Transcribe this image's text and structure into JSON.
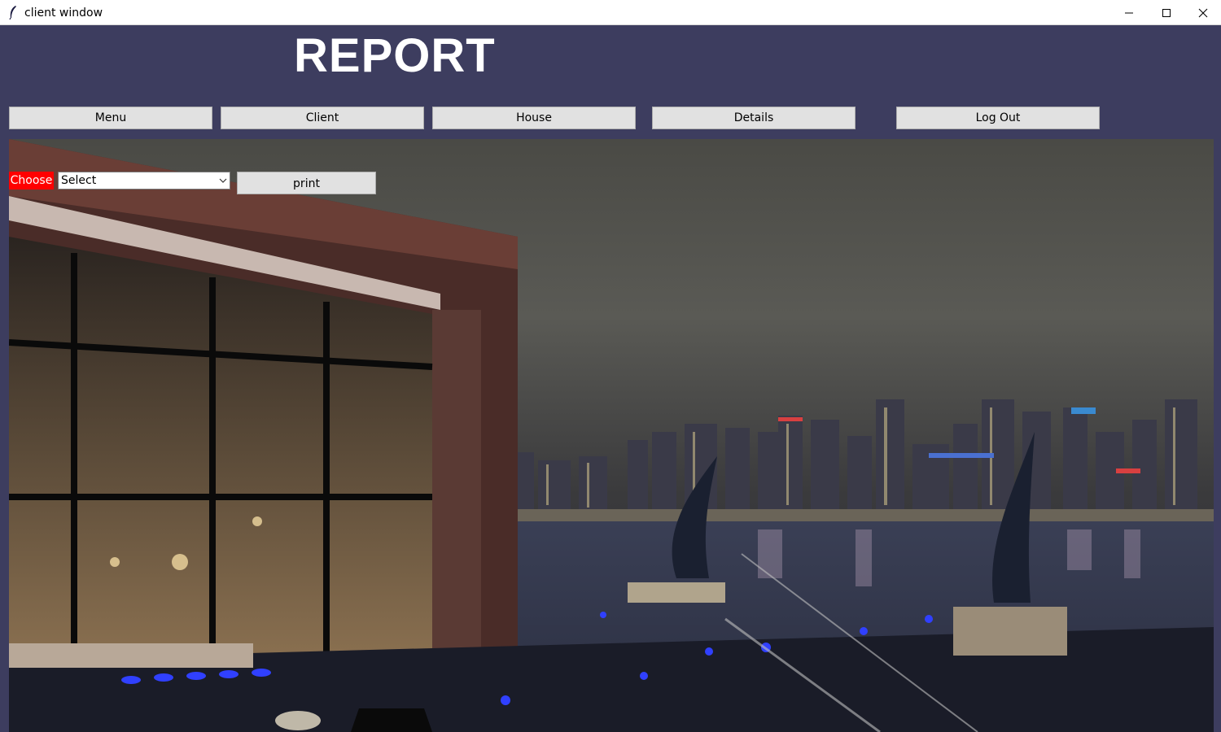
{
  "window": {
    "title": "client window"
  },
  "header": {
    "title": "REPORT"
  },
  "nav": {
    "menu": "Menu",
    "client": "Client",
    "house": "House",
    "details": "Details",
    "logout": "Log Out"
  },
  "form": {
    "choose_label": "Choose",
    "select_value": "Select",
    "print_label": "print"
  },
  "colors": {
    "background": "#3d3d5f",
    "choose_label_bg": "#ff0000",
    "button_bg": "#e1e1e1"
  },
  "icons": {
    "app": "feather-icon",
    "minimize": "minimize-icon",
    "maximize": "maximize-icon",
    "close": "close-icon",
    "dropdown": "chevron-down-icon"
  }
}
